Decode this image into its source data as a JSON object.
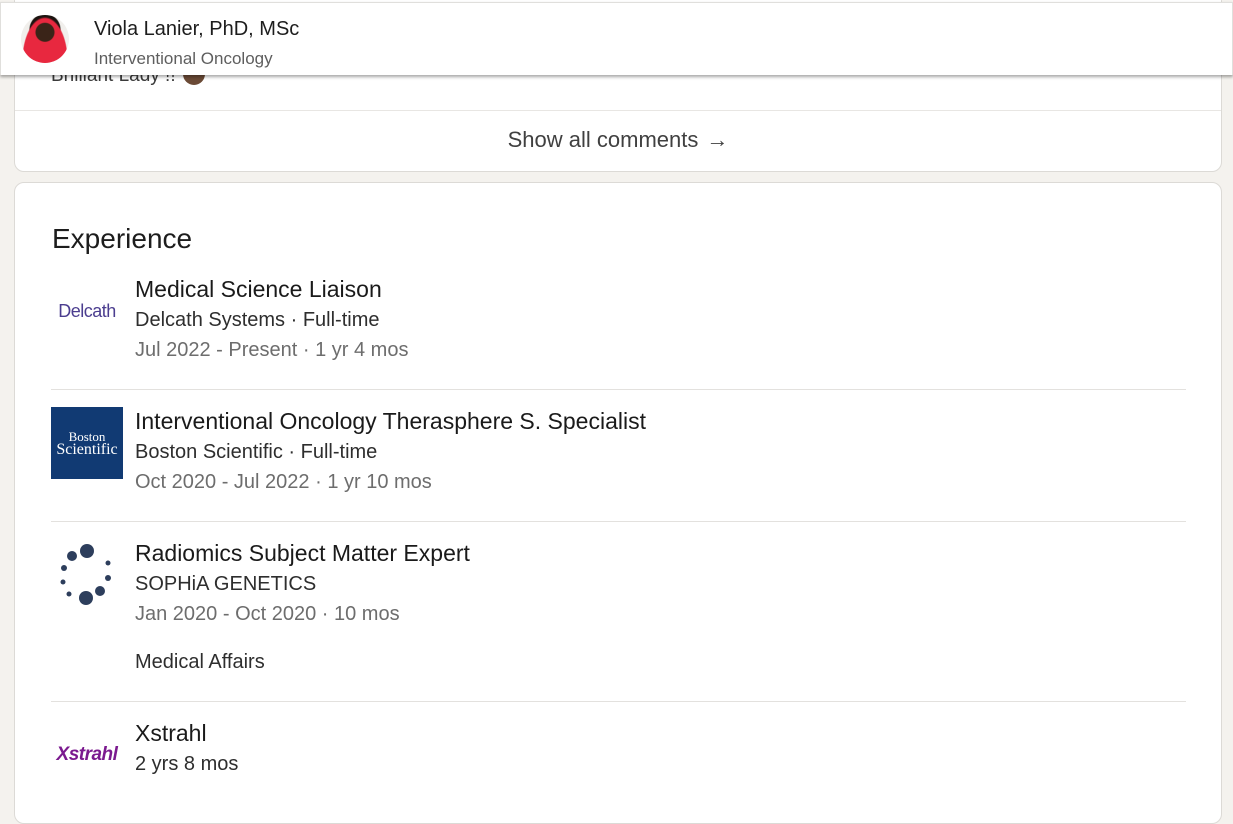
{
  "header": {
    "name": "Viola Lanier, PhD, MSc",
    "headline": "Interventional Oncology"
  },
  "comments": {
    "tail_text": "Brilliant Lady !!",
    "show_all_label": "Show all comments",
    "arrow": "→"
  },
  "experience": {
    "title": "Experience",
    "items": [
      {
        "logo_text": "Delcath",
        "role": "Medical Science Liaison",
        "company": "Delcath Systems · Full-time",
        "dates": "Jul 2022 - Present · 1 yr 4 mos"
      },
      {
        "logo_line1": "Boston",
        "logo_line2": "Scientific",
        "role": "Interventional Oncology Therasphere S. Specialist",
        "company": "Boston Scientific · Full-time",
        "dates": "Oct 2020 - Jul 2022 · 1 yr 10 mos"
      },
      {
        "role": "Radiomics Subject Matter Expert",
        "company": "SOPHiA GENETICS",
        "dates": "Jan 2020 - Oct 2020 · 10 mos",
        "description": "Medical Affairs"
      },
      {
        "logo_text": "Xstrahl",
        "role": "Xstrahl",
        "company": "2 yrs 8 mos"
      }
    ]
  },
  "colors": {
    "page_bg": "#f4f2ee",
    "boston_blue": "#113a73",
    "delcath_purple": "#4b3d8f",
    "sophia_navy": "#2d3e5c",
    "xstrahl_purple": "#7b1a8f"
  }
}
